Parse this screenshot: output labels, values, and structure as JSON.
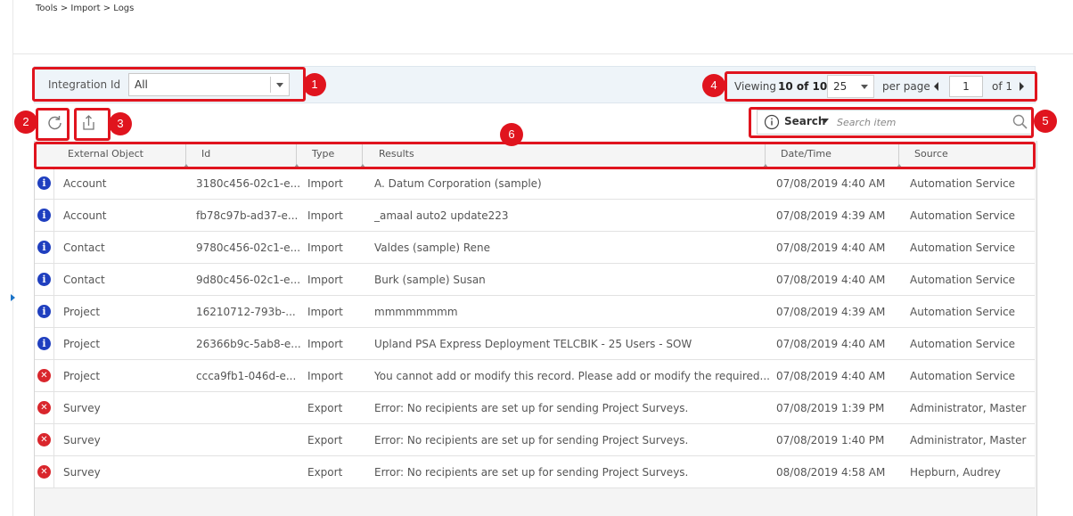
{
  "breadcrumb": "Tools > Import > Logs",
  "filter": {
    "label": "Integration Id",
    "value": "All"
  },
  "pager": {
    "viewing_label": "Viewing",
    "viewing_count": "10 of 10",
    "per_page_value": "25",
    "per_page_label": "per page",
    "page": "1",
    "of_label": "of 1"
  },
  "search": {
    "label": "Search",
    "placeholder": "Search item"
  },
  "callouts": [
    "1",
    "2",
    "3",
    "4",
    "5",
    "6"
  ],
  "columns": [
    "External Object",
    "Id",
    "Type",
    "Results",
    "Date/Time",
    "Source"
  ],
  "rows": [
    {
      "status": "info",
      "object": "Account",
      "id": "3180c456-02c1-e...",
      "type": "Import",
      "results": "A. Datum Corporation (sample)",
      "datetime": "07/08/2019 4:40 AM",
      "source": "Automation Service"
    },
    {
      "status": "info",
      "object": "Account",
      "id": "fb78c97b-ad37-e...",
      "type": "Import",
      "results": "_amaal auto2 update223",
      "datetime": "07/08/2019 4:39 AM",
      "source": "Automation Service"
    },
    {
      "status": "info",
      "object": "Contact",
      "id": "9780c456-02c1-e...",
      "type": "Import",
      "results": "Valdes (sample) Rene",
      "datetime": "07/08/2019 4:40 AM",
      "source": "Automation Service"
    },
    {
      "status": "info",
      "object": "Contact",
      "id": "9d80c456-02c1-e...",
      "type": "Import",
      "results": "Burk (sample) Susan",
      "datetime": "07/08/2019 4:40 AM",
      "source": "Automation Service"
    },
    {
      "status": "info",
      "object": "Project",
      "id": "16210712-793b-...",
      "type": "Import",
      "results": "mmmmmmmm",
      "datetime": "07/08/2019 4:39 AM",
      "source": "Automation Service"
    },
    {
      "status": "info",
      "object": "Project",
      "id": "26366b9c-5ab8-e...",
      "type": "Import",
      "results": "Upland PSA Express Deployment TELCBIK - 25 Users - SOW",
      "datetime": "07/08/2019 4:40 AM",
      "source": "Automation Service"
    },
    {
      "status": "error",
      "object": "Project",
      "id": "ccca9fb1-046d-e...",
      "type": "Import",
      "results": "You cannot add or modify this record. Please add or modify the required...",
      "datetime": "07/08/2019 4:40 AM",
      "source": "Automation Service"
    },
    {
      "status": "error",
      "object": "Survey",
      "id": "",
      "type": "Export",
      "results": "Error: No recipients are set up for sending Project Surveys.",
      "datetime": "07/08/2019 1:39 PM",
      "source": "Administrator, Master"
    },
    {
      "status": "error",
      "object": "Survey",
      "id": "",
      "type": "Export",
      "results": "Error: No recipients are set up for sending Project Surveys.",
      "datetime": "07/08/2019 1:40 PM",
      "source": "Administrator, Master"
    },
    {
      "status": "error",
      "object": "Survey",
      "id": "",
      "type": "Export",
      "results": "Error: No recipients are set up for sending Project Surveys.",
      "datetime": "08/08/2019 4:58 AM",
      "source": "Hepburn, Audrey"
    }
  ],
  "colors": {
    "callout": "#e0141e",
    "info": "#1f3fbf",
    "error": "#d9262c"
  }
}
